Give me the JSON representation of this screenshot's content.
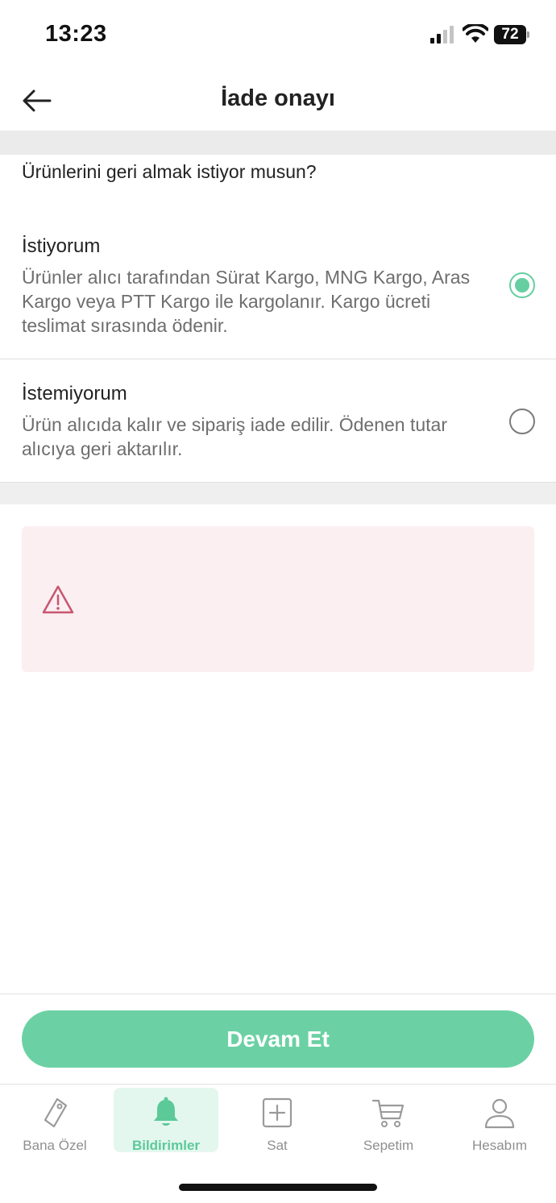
{
  "status": {
    "time": "13:23",
    "battery": "72"
  },
  "header": {
    "title": "İade onayı"
  },
  "question": "Ürünlerini geri almak istiyor musun?",
  "options": [
    {
      "title": "İstiyorum",
      "description": "Ürünler alıcı tarafından Sürat Kargo, MNG Kargo, Aras Kargo veya PTT Kargo ile kargolanır. Kargo ücreti teslimat sırasında ödenir.",
      "selected": true
    },
    {
      "title": "İstemiyorum",
      "description": "Ürün alıcıda kalır ve sipariş iade edilir. Ödenen tutar alıcıya geri aktarılır.",
      "selected": false
    }
  ],
  "primary_button": "Devam Et",
  "tabs": [
    {
      "label": "Bana Özel",
      "icon": "tag-icon",
      "active": false
    },
    {
      "label": "Bildirimler",
      "icon": "bell-icon",
      "active": true
    },
    {
      "label": "Sat",
      "icon": "plus-square-icon",
      "active": false
    },
    {
      "label": "Sepetim",
      "icon": "cart-icon",
      "active": false
    },
    {
      "label": "Hesabım",
      "icon": "user-icon",
      "active": false
    }
  ],
  "colors": {
    "accent": "#6bd1a4",
    "warning_bg": "#fbeff2",
    "warning_icon": "#c9566f"
  }
}
